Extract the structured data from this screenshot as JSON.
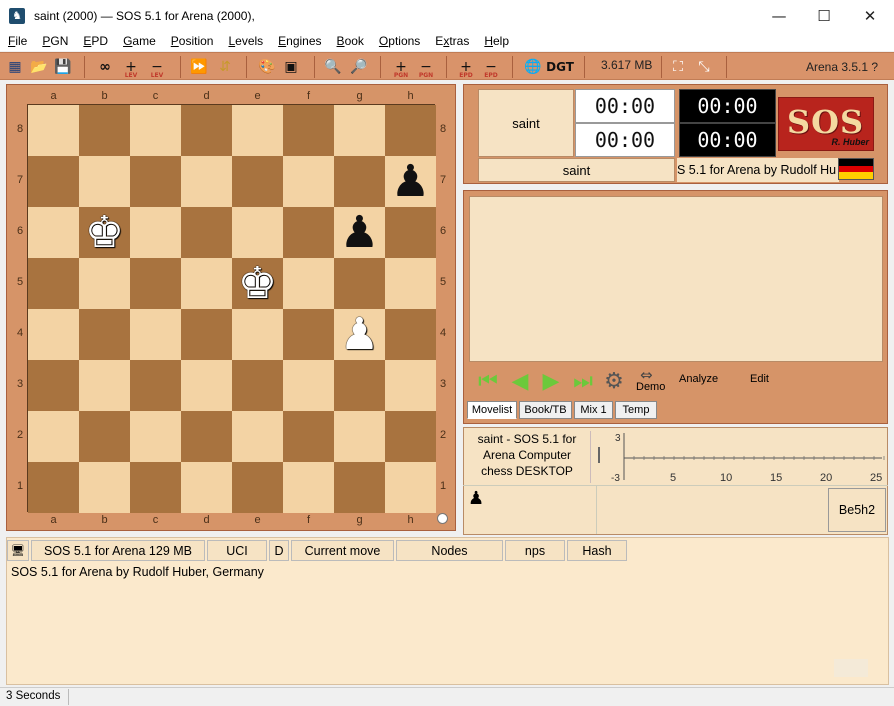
{
  "window": {
    "title": "saint (2000)  —  SOS 5.1 for Arena (2000),",
    "minimize": "—",
    "maximize": "☐",
    "close": "✕"
  },
  "menu": [
    {
      "label": "File",
      "key": "F"
    },
    {
      "label": "PGN",
      "key": "P"
    },
    {
      "label": "EPD",
      "key": "E"
    },
    {
      "label": "Game",
      "key": "G"
    },
    {
      "label": "Position",
      "key": "P"
    },
    {
      "label": "Levels",
      "key": "L"
    },
    {
      "label": "Engines",
      "key": "E"
    },
    {
      "label": "Book",
      "key": "B"
    },
    {
      "label": "Options",
      "key": "O"
    },
    {
      "label": "Extras",
      "key": "x"
    },
    {
      "label": "Help",
      "key": "H"
    }
  ],
  "toolbar": {
    "memory": "3.617 MB",
    "arena_version": "Arena 3.5.1",
    "help_glyph": "?",
    "lev_label": "LEV",
    "pgn_label": "PGN",
    "epd_label": "EPD",
    "infinity": "∞",
    "dgt_label": "DGT"
  },
  "board": {
    "files": [
      "a",
      "b",
      "c",
      "d",
      "e",
      "f",
      "g",
      "h"
    ],
    "ranks": [
      "8",
      "7",
      "6",
      "5",
      "4",
      "3",
      "2",
      "1"
    ],
    "light_color": "#f3d3a4",
    "dark_color": "#a8733f",
    "pieces": [
      {
        "square": "h7",
        "glyph": "♟",
        "color": "black"
      },
      {
        "square": "b6",
        "glyph": "♚",
        "color": "white"
      },
      {
        "square": "g6",
        "glyph": "♟",
        "color": "black"
      },
      {
        "square": "e5",
        "glyph": "♚",
        "color": "white"
      },
      {
        "square": "g4",
        "glyph": "♟",
        "color": "white"
      }
    ]
  },
  "clocks": {
    "player_top": "saint",
    "white_clock_1": "00:00",
    "white_clock_2": "00:00",
    "black_clock_1": "00:00",
    "black_clock_2": "00:00",
    "player_bottom": "saint",
    "engine_caption": "S 5.1 for Arena by Rudolf Hu",
    "logo_text": "SOS",
    "logo_sub": "R. Huber"
  },
  "movelist": {
    "demo_label": "Demo",
    "analyze_label": "Analyze",
    "edit_label": "Edit",
    "tabs": [
      "Movelist",
      "Book/TB",
      "Mix 1",
      "Temp"
    ]
  },
  "engine_info": {
    "description": "saint - SOS 5.1 for Arena Computer chess DESKTOP",
    "graph_y_top": "3",
    "graph_y_bottom": "-3",
    "graph_x_ticks": [
      "5",
      "10",
      "15",
      "20",
      "25"
    ],
    "best_move": "Be5h2",
    "pawn_glyph": "♟"
  },
  "engine_panel": {
    "header": {
      "name": "SOS 5.1 for Arena  129 MB",
      "protocol": "UCI",
      "d": "D",
      "current_move": "Current move",
      "nodes": "Nodes",
      "nps": "nps",
      "hash": "Hash"
    },
    "output": "SOS 5.1 for Arena by Rudolf Huber, Germany"
  },
  "status": {
    "text": "3 Seconds"
  }
}
